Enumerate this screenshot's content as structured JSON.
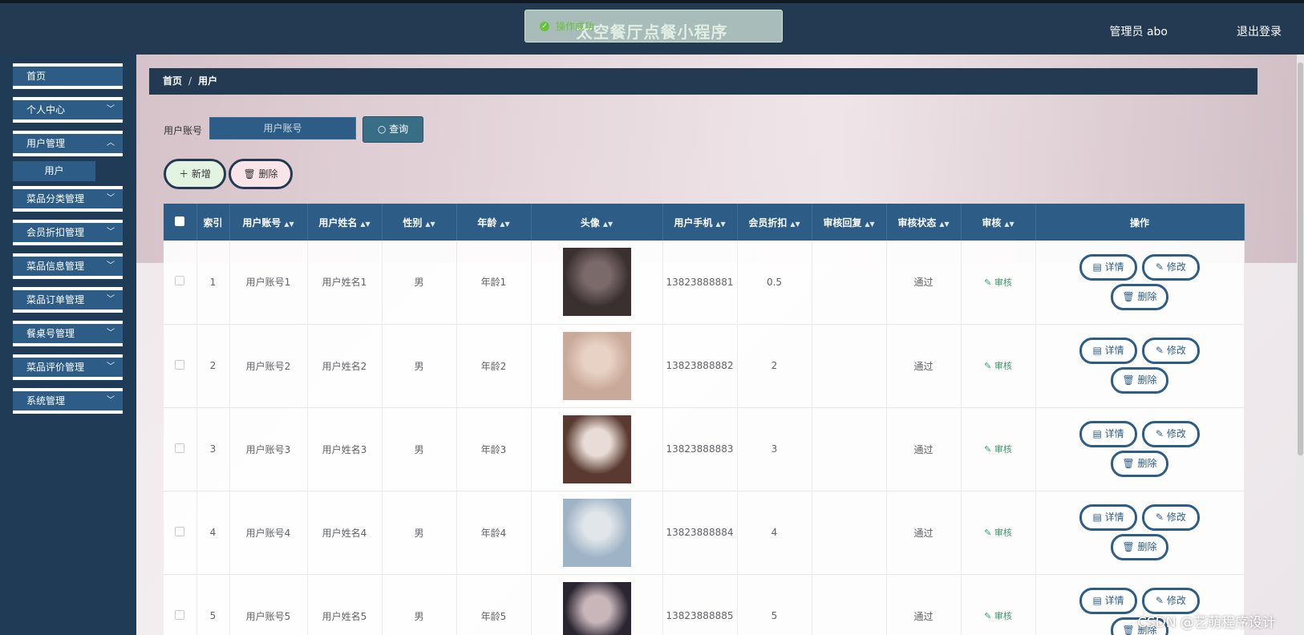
{
  "header": {
    "title": "太空餐厅点餐小程序",
    "toast": "操作成功",
    "admin": "管理员 abo",
    "logout": "退出登录"
  },
  "sidebar": {
    "items": [
      {
        "label": "首页"
      },
      {
        "label": "个人中心"
      },
      {
        "label": "用户管理"
      },
      {
        "label": "菜品分类管理"
      },
      {
        "label": "会员折扣管理"
      },
      {
        "label": "菜品信息管理"
      },
      {
        "label": "菜品订单管理"
      },
      {
        "label": "餐桌号管理"
      },
      {
        "label": "菜品评价管理"
      },
      {
        "label": "系统管理"
      }
    ],
    "sub_item": "用户"
  },
  "breadcrumb": {
    "home": "首页",
    "current": "用户"
  },
  "search": {
    "label": "用户账号",
    "placeholder": "用户账号",
    "query_button": "查询"
  },
  "actions": {
    "add": "新增",
    "delete": "删除"
  },
  "table": {
    "headers": [
      "索引",
      "用户账号",
      "用户姓名",
      "性别",
      "年龄",
      "头像",
      "用户手机",
      "会员折扣",
      "审核回复",
      "审核状态",
      "审核",
      "操作"
    ],
    "rows": [
      {
        "index": "1",
        "account": "用户账号1",
        "name": "用户姓名1",
        "gender": "男",
        "age": "年龄1",
        "phone": "13823888881",
        "discount": "0.5",
        "reply": "",
        "status": "通过",
        "audit": "审核"
      },
      {
        "index": "2",
        "account": "用户账号2",
        "name": "用户姓名2",
        "gender": "男",
        "age": "年龄2",
        "phone": "13823888882",
        "discount": "2",
        "reply": "",
        "status": "通过",
        "audit": "审核"
      },
      {
        "index": "3",
        "account": "用户账号3",
        "name": "用户姓名3",
        "gender": "男",
        "age": "年龄3",
        "phone": "13823888883",
        "discount": "3",
        "reply": "",
        "status": "通过",
        "audit": "审核"
      },
      {
        "index": "4",
        "account": "用户账号4",
        "name": "用户姓名4",
        "gender": "男",
        "age": "年龄4",
        "phone": "13823888884",
        "discount": "4",
        "reply": "",
        "status": "通过",
        "audit": "审核"
      },
      {
        "index": "5",
        "account": "用户账号5",
        "name": "用户姓名5",
        "gender": "男",
        "age": "年龄5",
        "phone": "13823888885",
        "discount": "5",
        "reply": "",
        "status": "通过",
        "audit": "审核"
      }
    ],
    "op_labels": {
      "detail": "详情",
      "edit": "修改",
      "delete": "删除"
    }
  },
  "watermark": "CSDN @艺萌程序设计",
  "colors": {
    "primary": "#2d5d86",
    "header": "#233a52",
    "success": "#67c23a"
  }
}
